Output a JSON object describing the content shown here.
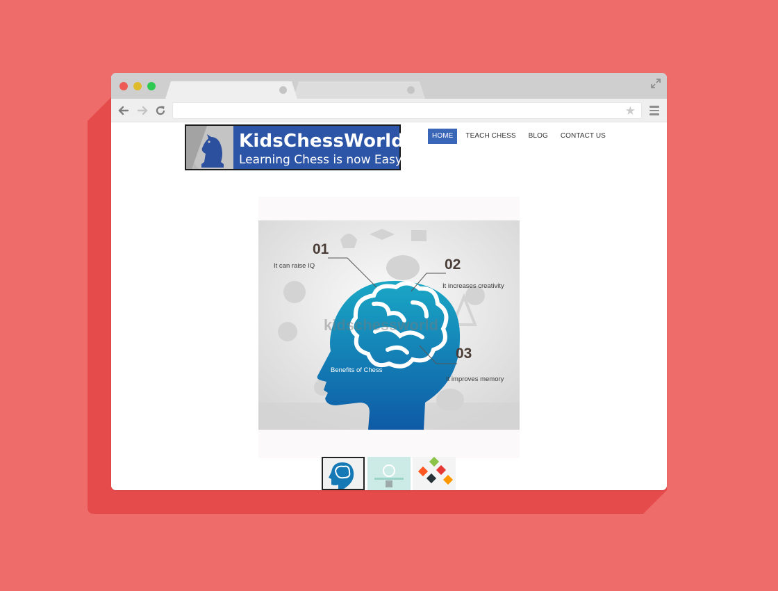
{
  "site": {
    "logo": {
      "title": "KidsChessWorld",
      "tagline": "Learning Chess is now Easy!"
    },
    "nav": [
      {
        "label": "HOME",
        "active": true
      },
      {
        "label": "TEACH CHESS",
        "active": false
      },
      {
        "label": "BLOG",
        "active": false
      },
      {
        "label": "CONTACT US",
        "active": false
      }
    ]
  },
  "hero": {
    "points": [
      {
        "number": "01",
        "text": "It can raise IQ"
      },
      {
        "number": "02",
        "text": "It increases creativity"
      },
      {
        "number": "03",
        "text": "It improves memory"
      }
    ],
    "caption": "Benefits of Chess",
    "watermark": "kidschessworld"
  },
  "colors": {
    "background": "#ee6c6a",
    "accent_nav": "#3a66b8",
    "logo_bg": "#2c54a7",
    "head_blue": "#1479b5"
  },
  "icons": [
    "back-icon",
    "forward-icon",
    "reload-icon",
    "star-icon",
    "menu-icon",
    "expand-icon"
  ]
}
